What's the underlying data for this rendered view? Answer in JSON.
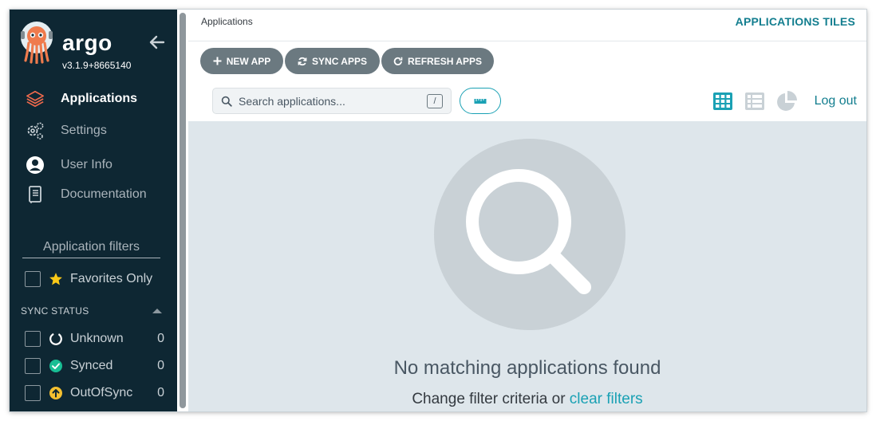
{
  "sidebar": {
    "brand": {
      "name": "argo",
      "version": "v3.1.9+8665140"
    },
    "nav": [
      {
        "label": "Applications",
        "icon": "layers-icon",
        "active": true
      },
      {
        "label": "Settings",
        "icon": "gears-icon",
        "active": false
      },
      {
        "label": "User Info",
        "icon": "user-circle-icon",
        "active": false
      },
      {
        "label": "Documentation",
        "icon": "book-icon",
        "active": false
      }
    ],
    "filters": {
      "title": "Application filters",
      "favorites_label": "Favorites Only",
      "sync_status": {
        "title": "SYNC STATUS",
        "items": [
          {
            "label": "Unknown",
            "count": "0",
            "icon": "circle-notch-icon"
          },
          {
            "label": "Synced",
            "count": "0",
            "icon": "check-circle-icon"
          },
          {
            "label": "OutOfSync",
            "count": "0",
            "icon": "arrow-up-circle-icon"
          }
        ]
      }
    }
  },
  "topbar": {
    "breadcrumb": "Applications",
    "title": "APPLICATIONS TILES"
  },
  "toolbar": {
    "new_app": "NEW APP",
    "sync_apps": "SYNC APPS",
    "refresh_apps": "REFRESH APPS",
    "search_placeholder": "Search applications...",
    "search_shortcut": "/",
    "logout": "Log out"
  },
  "empty_state": {
    "title": "No matching applications found",
    "hint_prefix": "Change filter criteria or ",
    "hint_link": "clear filters"
  },
  "colors": {
    "sidebar_bg": "#0e2733",
    "accent": "#1aa1b4",
    "button_bg": "#6b7980",
    "content_bg": "#dee6eb",
    "synced": "#18be94",
    "out_of_sync": "#f4c030",
    "favorite_star": "#fac917"
  }
}
